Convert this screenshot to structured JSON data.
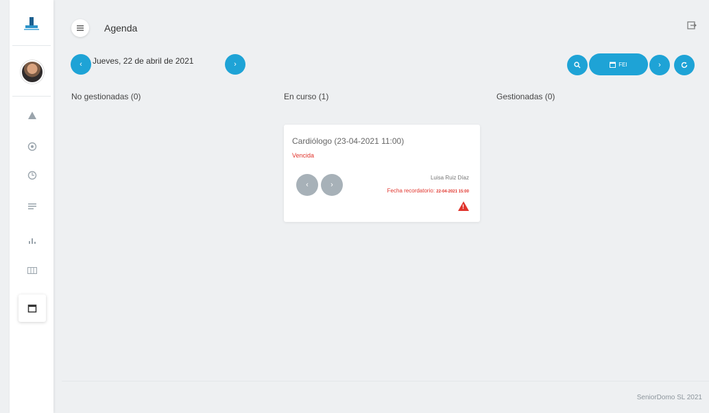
{
  "app": {
    "title": "Agenda"
  },
  "date_nav": {
    "label": "Jueves, 22 de abril de 2021"
  },
  "toolbar": {
    "pill_label": "FEI"
  },
  "columns": [
    {
      "label": "No gestionadas (0)"
    },
    {
      "label": "En curso (1)"
    },
    {
      "label": "Gestionadas (0)"
    }
  ],
  "card": {
    "title": "Cardiólogo (23-04-2021 11:00)",
    "status": "Vencida",
    "person": "Luisa Ruiz Díaz",
    "reminder_label": "Fecha recordatorio:",
    "reminder_value": "22-04-2021 15:00"
  },
  "footer": {
    "text": "SeniorDomo SL 2021"
  },
  "colors": {
    "accent": "#1ea3d6",
    "danger": "#e0342c",
    "button_gray": "#a7b1b8"
  },
  "icons": {
    "sidebar": [
      "logo-icon",
      "avatar",
      "warning-icon",
      "location-icon",
      "clock-icon",
      "list-icon",
      "bar-chart-icon",
      "grid-icon",
      "calendar-icon"
    ]
  }
}
